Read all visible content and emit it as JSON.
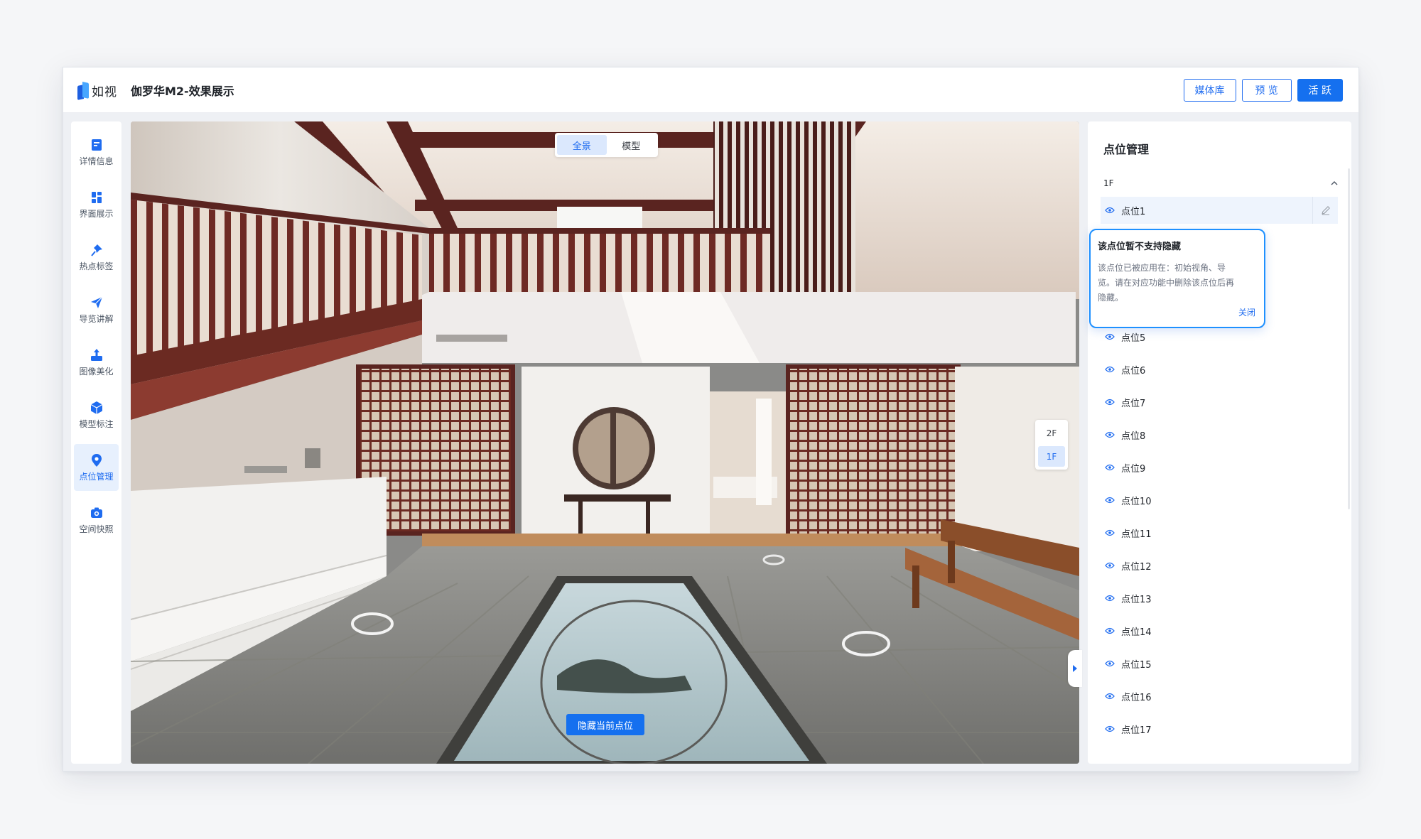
{
  "header": {
    "logo_text": "如视",
    "doc_title": "伽罗华M2-效果展示",
    "buttons": {
      "media_library": "媒体库",
      "preview": "预 览",
      "activate": "活 跃"
    }
  },
  "sidebar": {
    "items": [
      {
        "label": "详情信息",
        "icon": "info-card-icon"
      },
      {
        "label": "界面展示",
        "icon": "layout-icon"
      },
      {
        "label": "热点标签",
        "icon": "pin-tag-icon"
      },
      {
        "label": "导览讲解",
        "icon": "paper-plane-icon"
      },
      {
        "label": "图像美化",
        "icon": "image-enhance-icon"
      },
      {
        "label": "模型标注",
        "icon": "cube-icon"
      },
      {
        "label": "点位管理",
        "icon": "location-pin-icon",
        "active": true
      },
      {
        "label": "空间快照",
        "icon": "camera-icon"
      }
    ]
  },
  "viewer": {
    "view_modes": {
      "panorama": "全景",
      "model": "模型",
      "active": "全景"
    },
    "floors": {
      "upper": "2F",
      "lower": "1F",
      "active": "1F"
    },
    "hide_button": "隐藏当前点位"
  },
  "panel": {
    "title": "点位管理",
    "floor": "1F",
    "points": [
      "点位1",
      "点位5",
      "点位6",
      "点位7",
      "点位8",
      "点位9",
      "点位10",
      "点位11",
      "点位12",
      "点位13",
      "点位14",
      "点位15",
      "点位16",
      "点位17"
    ]
  },
  "popover": {
    "title": "该点位暂不支持隐藏",
    "body_line1": "该点位已被应用在：初始视角、导",
    "body_line2": "览。请在对应功能中删除该点位后再",
    "body_line3": "隐藏。",
    "close": "关闭"
  },
  "colors": {
    "primary": "#1570ef",
    "popover_border": "#1e90ff",
    "active_bg": "#e7f0fd"
  }
}
